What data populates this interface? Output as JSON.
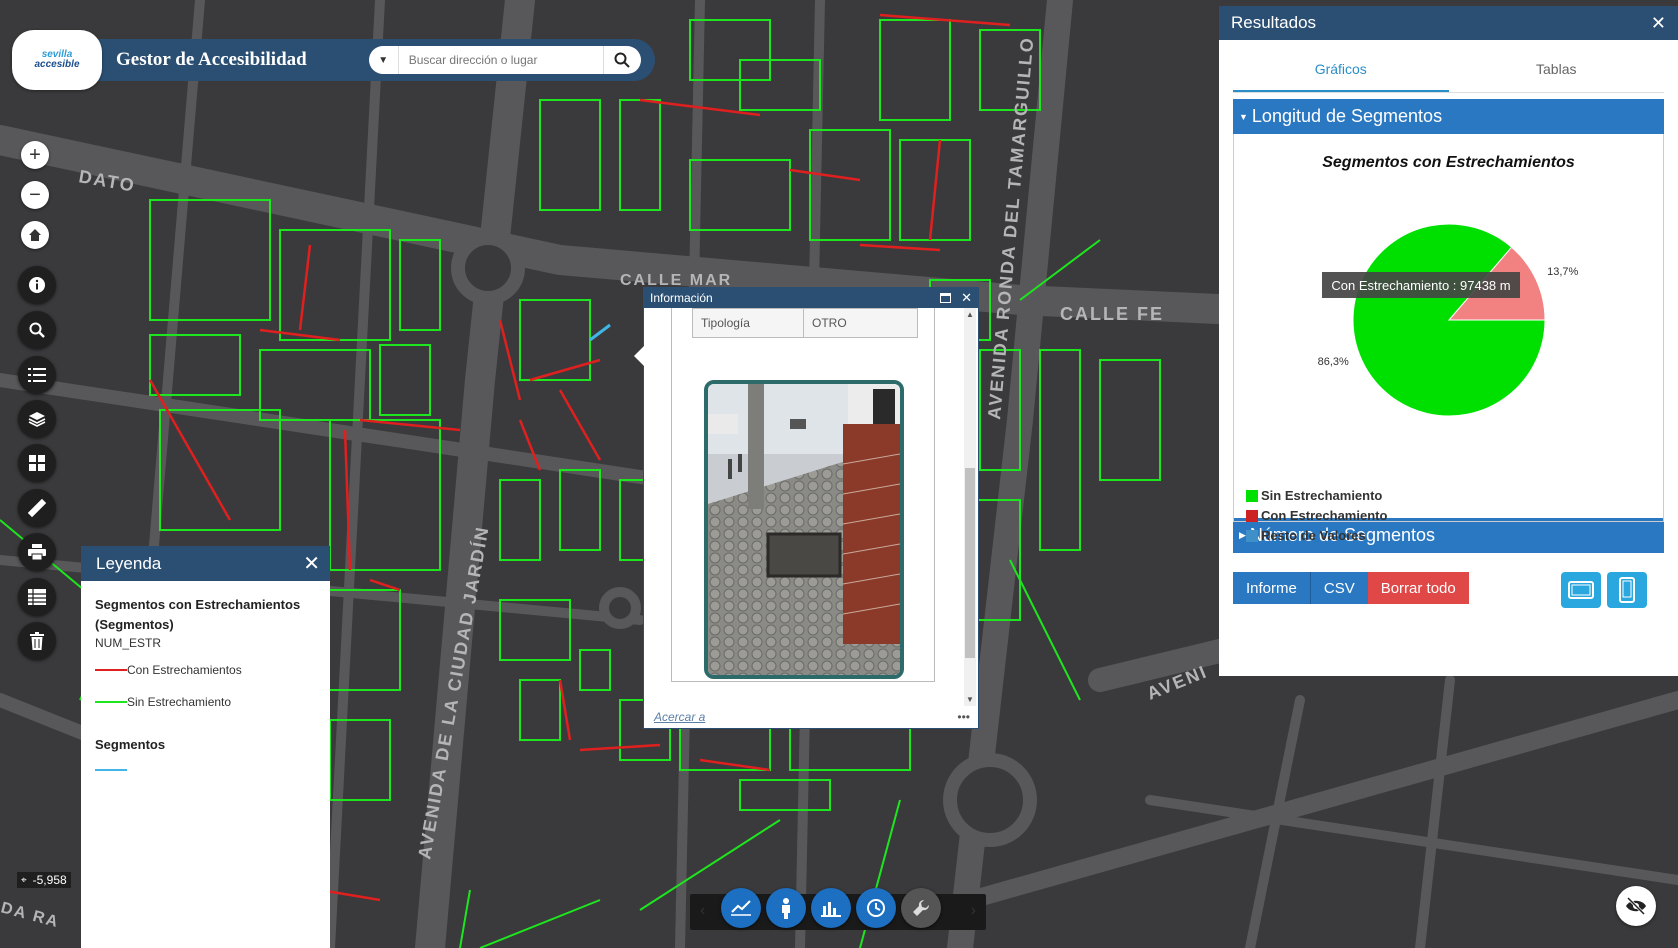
{
  "header": {
    "logo_text_1": "sevilla",
    "logo_text_2": "accesible",
    "title": "Gestor de Accesibilidad",
    "search_placeholder": "Buscar dirección o lugar"
  },
  "map": {
    "street_labels": [
      "CALLE FE",
      "AVENIDA RONDA DEL TAMARGUILLO",
      "AVENIDA DE LA CIUDAD JARDÍN",
      "AVENI",
      "CALLE MAR",
      "DATO",
      "DA RA"
    ],
    "colors": {
      "background": "#3a3a3c",
      "road": "#555558",
      "green": "#1ee61e",
      "red": "#e01f1f",
      "cyan": "#3fb6e6"
    },
    "scale_readout": "-5,958"
  },
  "left_toolbar": {
    "buttons": [
      "zoom-in-icon",
      "zoom-out-icon",
      "home-icon",
      "info-icon",
      "search-icon",
      "list-icon",
      "layers-icon",
      "grid-icon",
      "measure-icon",
      "print-icon",
      "table-icon",
      "trash-icon"
    ]
  },
  "legend": {
    "title": "Leyenda",
    "layer1_title": "Segmentos con Estrechamientos (Segmentos)",
    "layer1_field": "NUM_ESTR",
    "items": [
      {
        "label": "Con Estrechamientos",
        "color": "#e01f1f"
      },
      {
        "label": "Sin Estrechamiento",
        "color": "#1ee61e"
      }
    ],
    "layer2_title": "Segmentos",
    "layer2_color": "#3fb6e6"
  },
  "info_popup": {
    "title": "Información",
    "table": {
      "key": "Tipología",
      "value": "OTRO"
    },
    "zoom_link": "Acercar a",
    "more": "•••"
  },
  "results": {
    "title": "Resultados",
    "tabs": [
      {
        "label": "Gráficos",
        "active": true
      },
      {
        "label": "Tablas",
        "active": false
      }
    ],
    "section1": "Longitud de Segmentos",
    "section2": "Número de Segmentos",
    "buttons": {
      "informe": "Informe",
      "csv": "CSV",
      "borrar": "Borrar todo"
    }
  },
  "chart_data": {
    "type": "pie",
    "title": "Segmentos con Estrechamientos",
    "slices": [
      {
        "label": "Sin Estrechamiento",
        "percent": 86.3,
        "percent_label": "86,3%",
        "color": "#00e000"
      },
      {
        "label": "Con Estrechamiento",
        "percent": 13.7,
        "percent_label": "13,7%",
        "color": "#f28282"
      }
    ],
    "legend": [
      {
        "label": "Sin Estrechamiento",
        "color": "#00e000"
      },
      {
        "label": "Con Estrechamiento",
        "color": "#cc2222"
      },
      {
        "label": "Resto de Valores",
        "color": "#3f8fc9"
      }
    ],
    "tooltip": "Con Estrechamiento : 97438 m",
    "legend_position": "bottom-left"
  }
}
